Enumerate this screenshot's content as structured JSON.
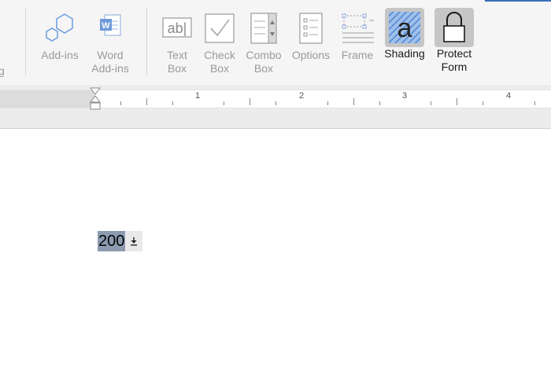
{
  "ribbon": {
    "cut_label": "g",
    "buttons": [
      {
        "id": "add-ins",
        "label": "Add-ins",
        "icon": "hexagon-addins-icon"
      },
      {
        "id": "word-add-ins",
        "label": "Word\nAdd-ins",
        "icon": "word-document-icon"
      },
      {
        "id": "text-box",
        "label": "Text\nBox",
        "icon": "text-box-ab-icon"
      },
      {
        "id": "check-box",
        "label": "Check\nBox",
        "icon": "checkbox-icon"
      },
      {
        "id": "combo-box",
        "label": "Combo\nBox",
        "icon": "combo-box-icon"
      },
      {
        "id": "options",
        "label": "Options",
        "icon": "options-list-icon"
      },
      {
        "id": "frame",
        "label": "Frame",
        "icon": "frame-icon"
      },
      {
        "id": "shading",
        "label": "Shading",
        "icon": "shading-icon",
        "active": true
      },
      {
        "id": "protect-form",
        "label": "Protect\nForm",
        "icon": "padlock-icon",
        "active": true
      }
    ],
    "word_icon_letter": "W",
    "text_box_icon_text": "ab|",
    "shading_icon_letter": "a"
  },
  "ruler": {
    "numbers": [
      "1",
      "2",
      "3",
      "4"
    ]
  },
  "document": {
    "field_value": "200",
    "field_dropdown_icon": "download-arrow-icon"
  },
  "colors": {
    "ribbon_bg": "#f5f5f5",
    "active_button_bg": "#c6c6c6",
    "field_highlight": "#8d9bb0",
    "icon_blue": "#5b8fd6"
  }
}
